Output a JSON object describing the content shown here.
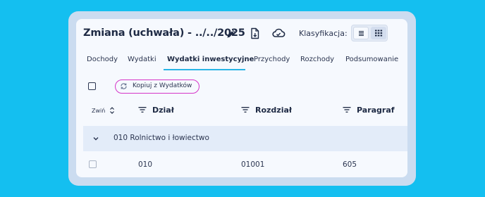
{
  "header": {
    "title": "Zmiana (uchwała) - ../../2025",
    "classification_label": "Klasyfikacja:",
    "icons": [
      "edit-pencil-icon",
      "export-file-icon",
      "cloud-sync-icon",
      "list-view-icon",
      "grid-view-icon"
    ]
  },
  "tabs": [
    {
      "label": "Dochody",
      "active": false
    },
    {
      "label": "Wydatki",
      "active": false
    },
    {
      "label": "Wydatki inwestycyjne",
      "active": true
    },
    {
      "label": "Przychody",
      "active": false
    },
    {
      "label": "Rozchody",
      "active": false
    },
    {
      "label": "Podsumowanie",
      "active": false
    }
  ],
  "toolbar": {
    "copy_button": "Kopiuj z Wydatków"
  },
  "table": {
    "collapse_label": "Zwiń",
    "columns": [
      "Dział",
      "Rozdział",
      "Paragraf"
    ],
    "group": {
      "label": "010 Rolnictwo i łowiectwo"
    },
    "rows": [
      {
        "dzial": "010",
        "rozdzial": "01001",
        "paragraf": "605"
      }
    ]
  },
  "colors": {
    "background": "#14bff0",
    "accent_tab": "#28b4e6",
    "copy_button_border": "#d535c8",
    "group_row": "#e3ecf9"
  }
}
